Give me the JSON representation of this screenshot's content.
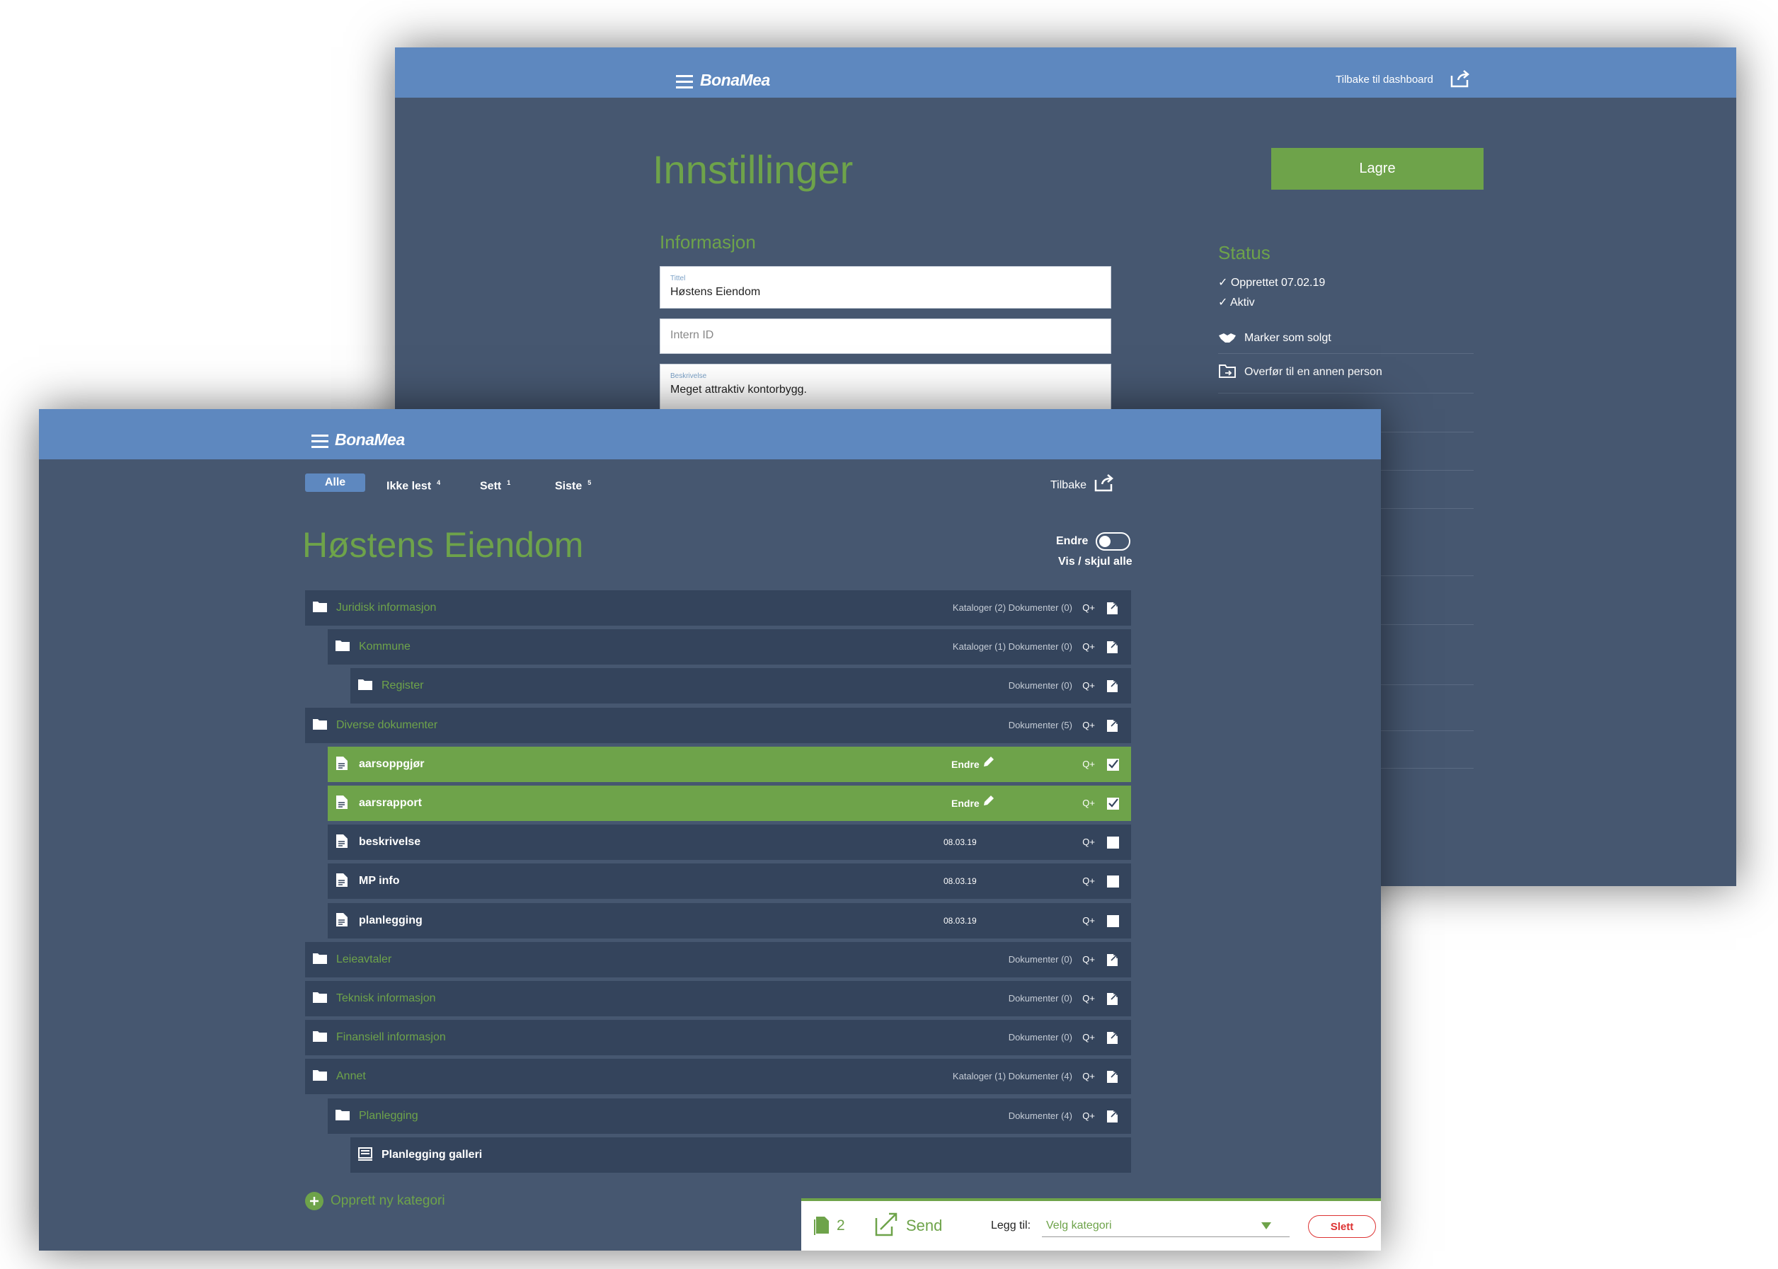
{
  "back_window": {
    "brand": "BonaMea",
    "back_link": "Tilbake til dashboard",
    "page_title": "Innstillinger",
    "save_button": "Lagre",
    "info_heading": "Informasjon",
    "fields": {
      "title_caption": "Tittel",
      "title_value": "Høstens Eiendom",
      "intern_placeholder": "Intern ID",
      "desc_caption": "Beskrivelse",
      "desc_value": "Meget attraktiv kontorbygg."
    },
    "status_heading": "Status",
    "status_items": [
      "✓ Opprettet 07.02.19",
      "✓ Aktiv"
    ],
    "actions": [
      "Marker som solgt",
      "Overfør til en annen person"
    ]
  },
  "front_window": {
    "brand": "BonaMea",
    "tabs": [
      {
        "label": "Alle",
        "count": ""
      },
      {
        "label": "Ikke lest",
        "count": "4"
      },
      {
        "label": "Sett",
        "count": "1"
      },
      {
        "label": "Siste",
        "count": "5"
      }
    ],
    "back_link": "Tilbake",
    "page_title": "Høstens Eiendom",
    "edit_toggle_label": "Endre",
    "show_hide_all": "Vis / skjul alle",
    "qplus": "Q+",
    "edit_label": "Endre",
    "rows": [
      {
        "type": "folder",
        "level": 0,
        "name": "Juridisk informasjon",
        "meta": "Kataloger (2) Dokumenter (0)"
      },
      {
        "type": "folder",
        "level": 1,
        "name": "Kommune",
        "meta": "Kataloger (1) Dokumenter (0)"
      },
      {
        "type": "folder",
        "level": 2,
        "name": "Register",
        "meta": "Dokumenter (0)"
      },
      {
        "type": "folder",
        "level": 0,
        "name": "Diverse dokumenter",
        "meta": "Dokumenter (5)"
      },
      {
        "type": "doc",
        "level": 1,
        "name": "aarsoppgjør",
        "selected": true
      },
      {
        "type": "doc",
        "level": 1,
        "name": "aarsrapport",
        "selected": true
      },
      {
        "type": "doc",
        "level": 1,
        "name": "beskrivelse",
        "date": "08.03.19"
      },
      {
        "type": "doc",
        "level": 1,
        "name": "MP info",
        "date": "08.03.19"
      },
      {
        "type": "doc",
        "level": 1,
        "name": "planlegging",
        "date": "08.03.19"
      },
      {
        "type": "folder",
        "level": 0,
        "name": "Leieavtaler",
        "meta": "Dokumenter (0)"
      },
      {
        "type": "folder",
        "level": 0,
        "name": "Teknisk informasjon",
        "meta": "Dokumenter (0)"
      },
      {
        "type": "folder",
        "level": 0,
        "name": "Finansiell informasjon",
        "meta": "Dokumenter (0)"
      },
      {
        "type": "folder",
        "level": 0,
        "name": "Annet",
        "meta": "Kataloger (1) Dokumenter (4)"
      },
      {
        "type": "folder",
        "level": 1,
        "name": "Planlegging",
        "meta": "Dokumenter (4)"
      },
      {
        "type": "gallery",
        "level": 2,
        "name": "Planlegging galleri"
      }
    ],
    "create_category": "Opprett ny kategori",
    "bottom_bar": {
      "count": "2",
      "send": "Send",
      "add_to": "Legg til:",
      "select_placeholder": "Velg kategori",
      "delete": "Slett"
    }
  }
}
